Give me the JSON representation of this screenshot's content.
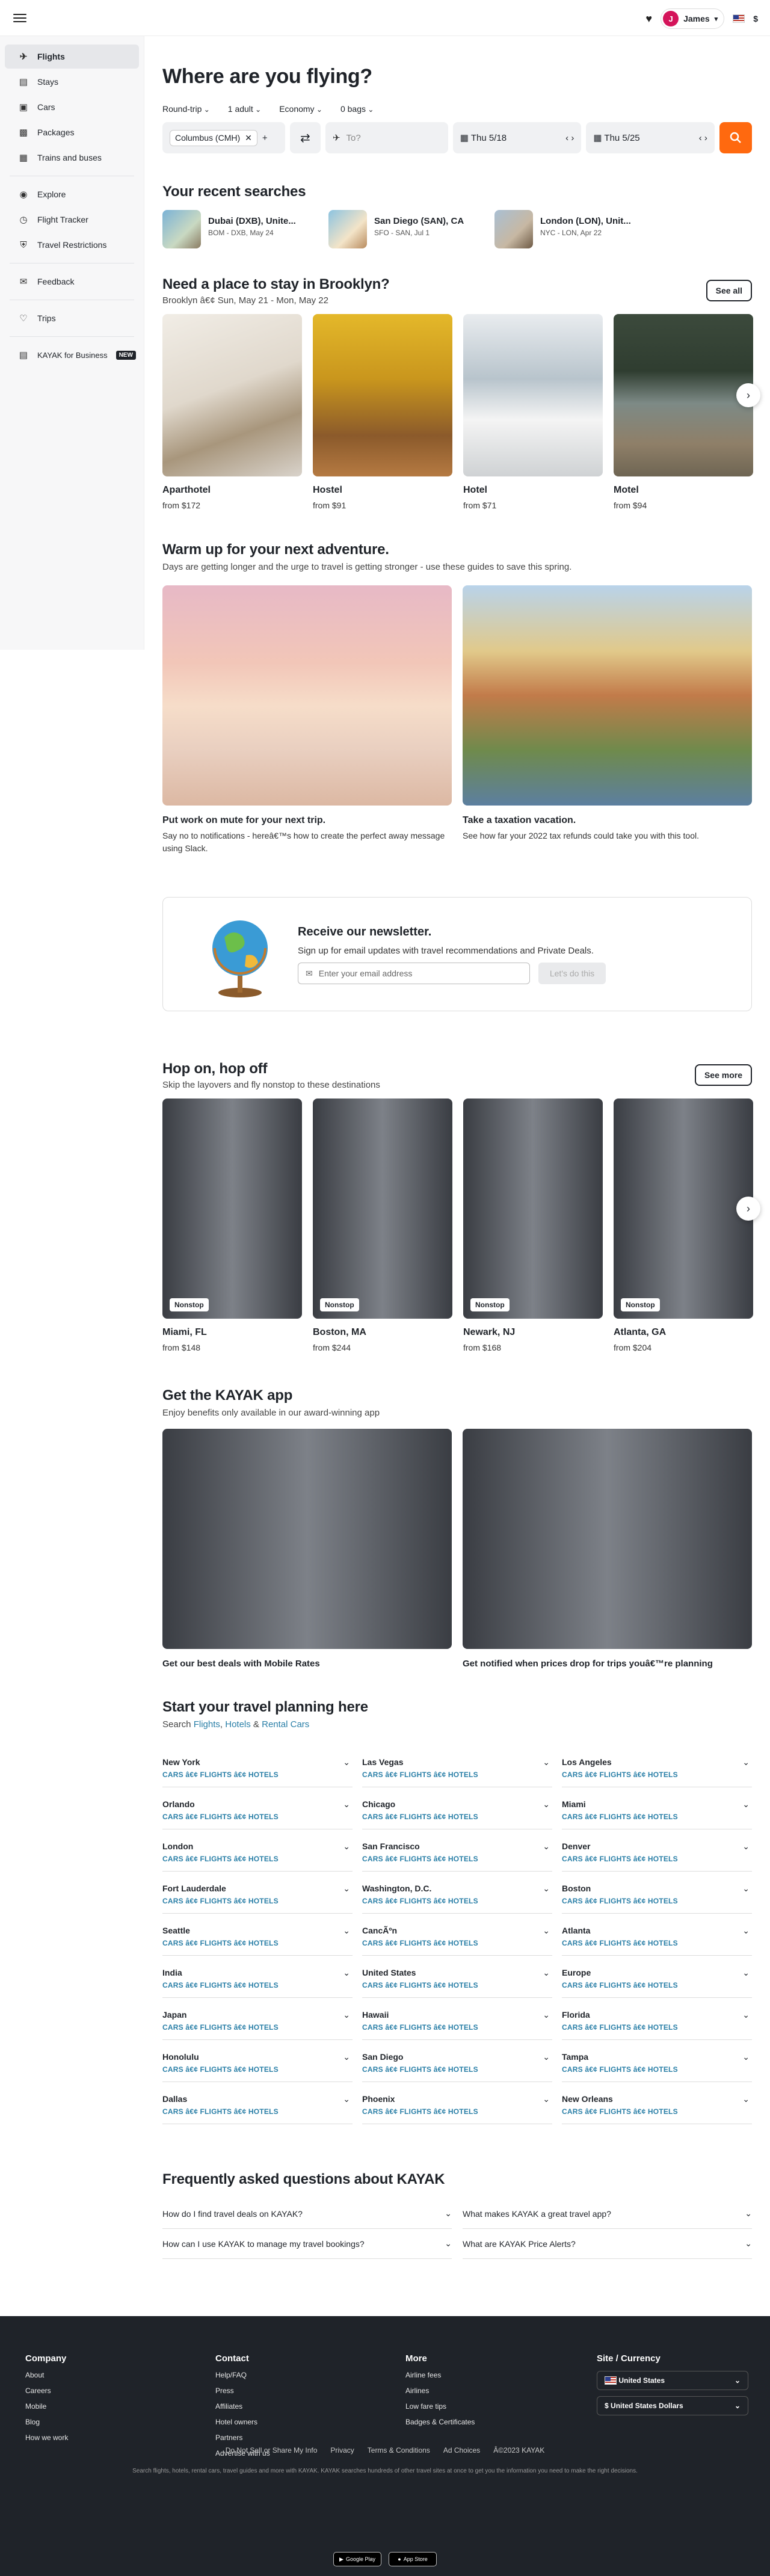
{
  "header": {
    "user_initial": "J",
    "user_name": "James",
    "currency": "$"
  },
  "sidebar": {
    "items": [
      {
        "label": "Flights",
        "icon": "plane-icon",
        "active": true
      },
      {
        "label": "Stays",
        "icon": "bed-icon"
      },
      {
        "label": "Cars",
        "icon": "car-icon"
      },
      {
        "label": "Packages",
        "icon": "suitcase-icon"
      },
      {
        "label": "Trains and buses",
        "icon": "train-icon"
      },
      {
        "label": "Explore",
        "icon": "explore-icon"
      },
      {
        "label": "Flight Tracker",
        "icon": "clock-icon"
      },
      {
        "label": "Travel Restrictions",
        "icon": "shield-icon"
      },
      {
        "label": "Feedback",
        "icon": "chat-icon"
      },
      {
        "label": "Trips",
        "icon": "heart-icon"
      },
      {
        "label": "KAYAK for Business",
        "icon": "briefcase-icon",
        "badge": "NEW"
      }
    ]
  },
  "search": {
    "title": "Where are you flying?",
    "trip_type": "Round-trip",
    "travelers": "1 adult",
    "cabin": "Economy",
    "bags": "0 bags",
    "origin": "Columbus (CMH)",
    "destination_placeholder": "To?",
    "depart": "Thu 5/18",
    "return": "Thu 5/25"
  },
  "recent": {
    "title": "Your recent searches",
    "items": [
      {
        "title": "Dubai (DXB), Unite...",
        "sub": "BOM - DXB, May 24"
      },
      {
        "title": "San Diego (SAN), CA",
        "sub": "SFO - SAN, Jul 1"
      },
      {
        "title": "London (LON), Unit...",
        "sub": "NYC - LON, Apr 22"
      }
    ]
  },
  "stays": {
    "title": "Need a place to stay in Brooklyn?",
    "subtitle": "Brooklyn â€¢ Sun, May 21 - Mon, May 22",
    "see_all": "See all",
    "items": [
      {
        "title": "Aparthotel",
        "price": "from $172"
      },
      {
        "title": "Hostel",
        "price": "from $91"
      },
      {
        "title": "Hotel",
        "price": "from $71"
      },
      {
        "title": "Motel",
        "price": "from $94"
      }
    ]
  },
  "adventure": {
    "title": "Warm up for your next adventure.",
    "subtitle": "Days are getting longer and the urge to travel is getting stronger - use these guides to save this spring.",
    "items": [
      {
        "title": "Put work on mute for your next trip.",
        "desc": "Say no to notifications - hereâ€™s how to create the perfect away message using Slack."
      },
      {
        "title": "Take a taxation vacation.",
        "desc": "See how far your 2022 tax refunds could take you with this tool."
      }
    ]
  },
  "newsletter": {
    "title": "Receive our newsletter.",
    "subtitle": "Sign up for email updates with travel recommendations and Private Deals.",
    "placeholder": "Enter your email address",
    "button": "Let's do this"
  },
  "hop": {
    "title": "Hop on, hop off",
    "subtitle": "Skip the layovers and fly nonstop to these destinations",
    "see_more": "See more",
    "badge": "Nonstop",
    "items": [
      {
        "title": "Miami, FL",
        "price": "from $148"
      },
      {
        "title": "Boston, MA",
        "price": "from $244"
      },
      {
        "title": "Newark, NJ",
        "price": "from $168"
      },
      {
        "title": "Atlanta, GA",
        "price": "from $204"
      }
    ]
  },
  "app": {
    "title": "Get the KAYAK app",
    "subtitle": "Enjoy benefits only available in our award-winning app",
    "items": [
      {
        "title": "Get our best deals with Mobile Rates"
      },
      {
        "title": "Get notified when prices drop for trips youâ€™re planning"
      }
    ]
  },
  "planning": {
    "title": "Start your travel planning here",
    "sub_prefix": "Search ",
    "link1": "Flights",
    "sep1": ", ",
    "link2": "Hotels",
    "sep2": " & ",
    "link3": "Rental Cars",
    "links_text": "CARS â€¢ FLIGHTS â€¢ HOTELS",
    "cities": [
      "New York",
      "Las Vegas",
      "Los Angeles",
      "Orlando",
      "Chicago",
      "Miami",
      "London",
      "San Francisco",
      "Denver",
      "Fort Lauderdale",
      "Washington, D.C.",
      "Boston",
      "Seattle",
      "CancÃºn",
      "Atlanta",
      "India",
      "United States",
      "Europe",
      "Japan",
      "Hawaii",
      "Florida",
      "Honolulu",
      "San Diego",
      "Tampa",
      "Dallas",
      "Phoenix",
      "New Orleans"
    ]
  },
  "faq": {
    "title": "Frequently asked questions about KAYAK",
    "items": [
      "How do I find travel deals on KAYAK?",
      "What makes KAYAK a great travel app?",
      "How can I use KAYAK to manage my travel bookings?",
      "What are KAYAK Price Alerts?"
    ]
  },
  "footer": {
    "company": {
      "title": "Company",
      "links": [
        "About",
        "Careers",
        "Mobile",
        "Blog",
        "How we work"
      ]
    },
    "contact": {
      "title": "Contact",
      "links": [
        "Help/FAQ",
        "Press",
        "Affiliates",
        "Hotel owners",
        "Partners",
        "Advertise with us"
      ]
    },
    "more": {
      "title": "More",
      "links": [
        "Airline fees",
        "Airlines",
        "Low fare tips",
        "Badges & Certificates"
      ]
    },
    "site": {
      "title": "Site / Currency",
      "country": "United States",
      "currency": "United States Dollars"
    },
    "bottom_links": [
      "Do Not Sell or Share My Info",
      "Privacy",
      "Terms & Conditions",
      "Ad Choices",
      "Â©2023 KAYAK"
    ],
    "note": "Search flights, hotels, rental cars, travel guides and more with KAYAK. KAYAK searches hundreds of other travel sites at once to get you the information you need to make the right decisions.",
    "store1": "Google Play",
    "store2": "App Store"
  }
}
